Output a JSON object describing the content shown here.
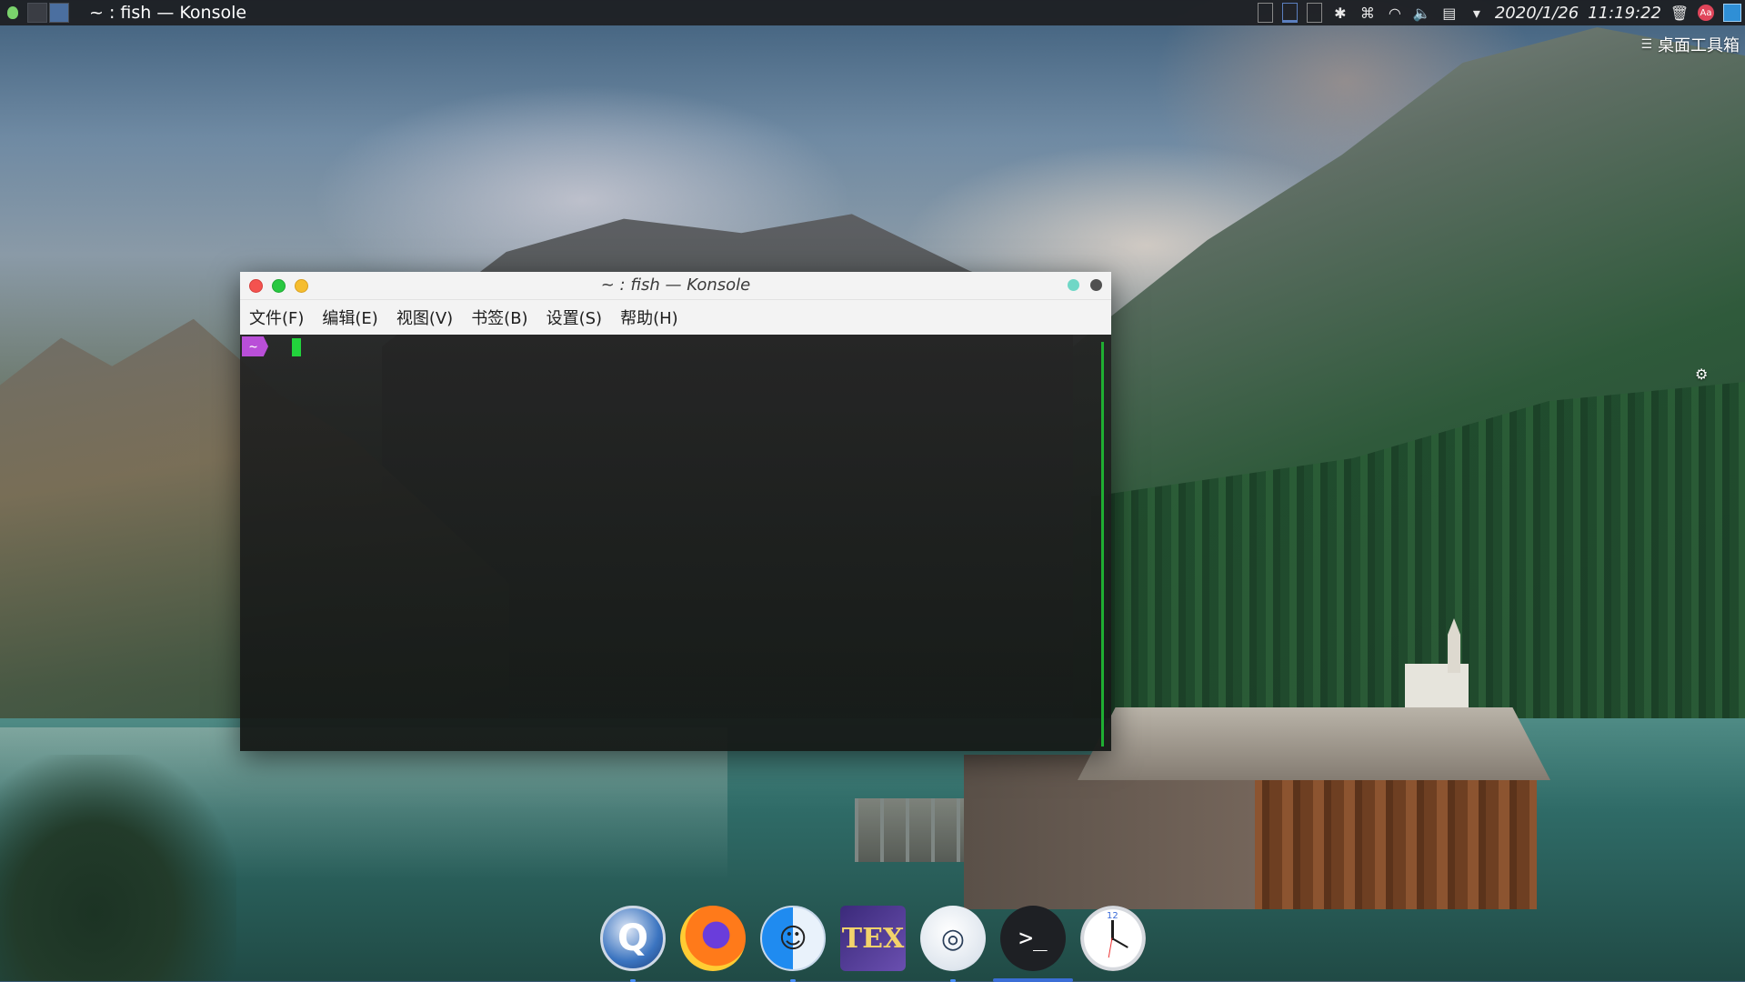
{
  "top_panel": {
    "window_title": "~ : fish — Konsole",
    "date": "2020/1/26",
    "time": "11:19:22",
    "notification_badge": "Aa",
    "tray_icons": [
      "bluetooth-icon",
      "keyboard-icon",
      "wifi-icon",
      "volume-icon",
      "clipboard-icon",
      "expand-arrow-icon",
      "trash-icon"
    ]
  },
  "desktop": {
    "toolbox_label": "桌面工具箱"
  },
  "konsole": {
    "title": "~ : fish — Konsole",
    "menu": [
      "文件(F)",
      "编辑(E)",
      "视图(V)",
      "书签(B)",
      "设置(S)",
      "帮助(H)"
    ],
    "prompt": "~",
    "colors": {
      "prompt_bg": "#b94fd8",
      "cursor": "#22d33c"
    }
  },
  "dock": {
    "apps": [
      "qtcreator-icon",
      "firefox-icon",
      "finder-icon",
      "texstudio-icon",
      "preview-icon",
      "terminal-icon",
      "clock-icon"
    ],
    "tex_label": "TEX",
    "terminal_label": ">_",
    "clock_label": "12"
  }
}
